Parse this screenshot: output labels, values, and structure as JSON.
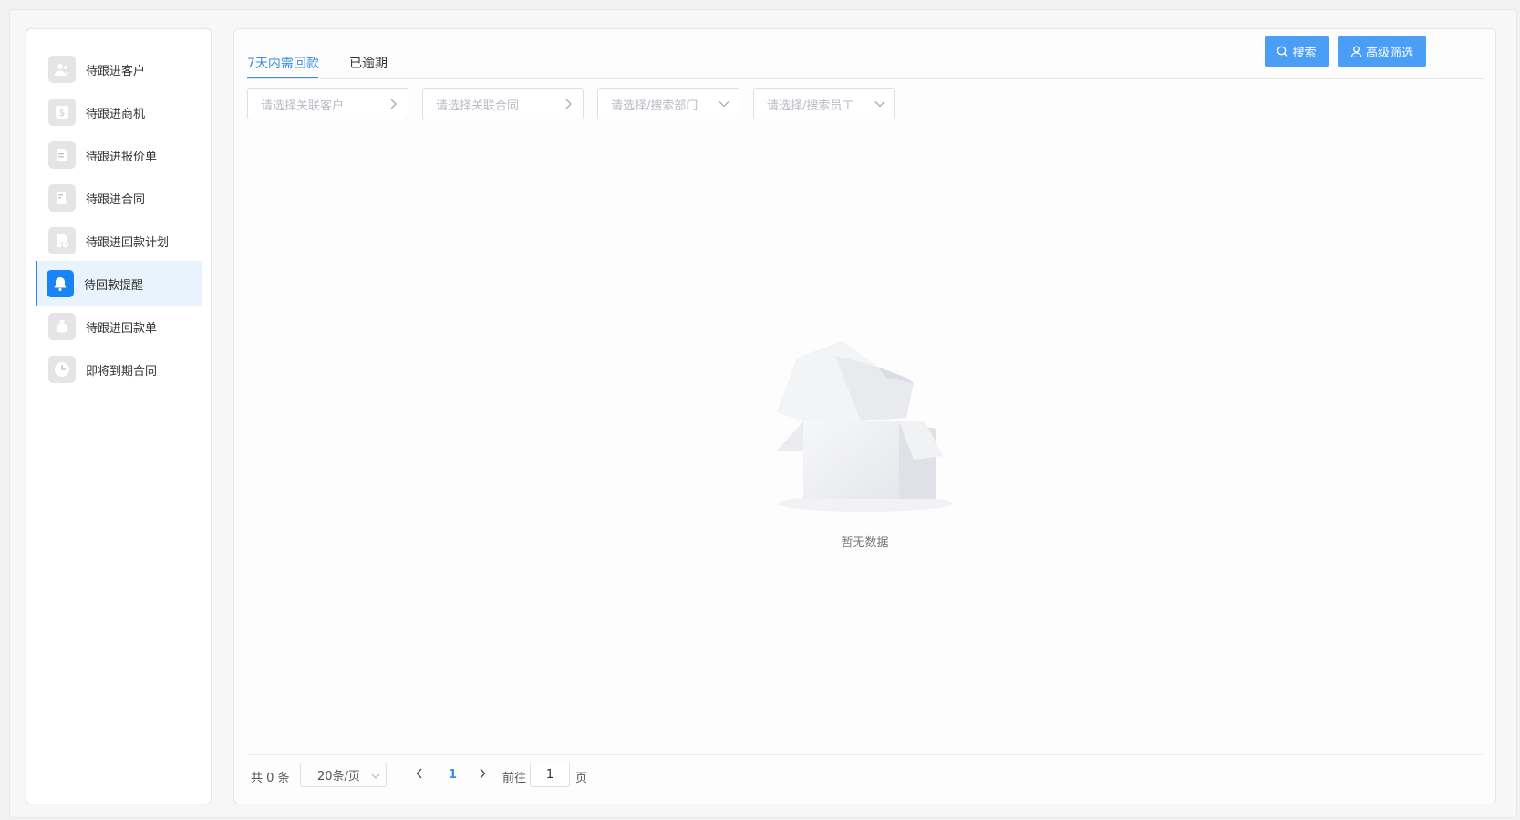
{
  "sidebar": {
    "items": [
      {
        "label": "待跟进客户",
        "icon": "customer-icon"
      },
      {
        "label": "待跟进商机",
        "icon": "opportunity-icon"
      },
      {
        "label": "待跟进报价单",
        "icon": "quotation-icon"
      },
      {
        "label": "待跟进合同",
        "icon": "contract-icon"
      },
      {
        "label": "待跟进回款计划",
        "icon": "payment-plan-icon"
      },
      {
        "label": "待回款提醒",
        "icon": "bell-icon",
        "active": true
      },
      {
        "label": "待跟进回款单",
        "icon": "money-bag-icon"
      },
      {
        "label": "即将到期合同",
        "icon": "clock-icon"
      }
    ]
  },
  "tabs": [
    {
      "label": "7天内需回款",
      "active": true
    },
    {
      "label": "已逾期"
    }
  ],
  "buttons": {
    "search": "搜索",
    "advanced": "高级筛选"
  },
  "filters": {
    "customer": "请选择关联客户",
    "contract": "请选择关联合同",
    "department": "请选择/搜索部门",
    "employee": "请选择/搜索员工"
  },
  "empty": {
    "text": "暂无数据"
  },
  "pagination": {
    "total": "共 0 条",
    "page_size": "20条/页",
    "current": "1",
    "goto_prefix": "前往",
    "goto_value": "1",
    "goto_suffix": "页"
  },
  "colors": {
    "accent": "#1a84f7",
    "button": "#4a9ef5",
    "active_bg": "#e9f3fe"
  }
}
